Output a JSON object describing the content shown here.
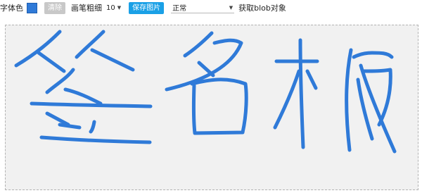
{
  "toolbar": {
    "color_label": "字体色",
    "clear_label": "清除",
    "brush_width_label": "画笔粗细",
    "brush_size_value": "10",
    "save_label": "保存图片",
    "mode_value": "正常",
    "blob_label": "获取blob对象"
  },
  "colors": {
    "stroke": "#2f7ad8",
    "canvas_bg": "#f1f1f1",
    "save_button": "#1aa0e6",
    "clear_button": "#c8c8c8"
  },
  "canvas": {
    "drawing": "签名板"
  }
}
